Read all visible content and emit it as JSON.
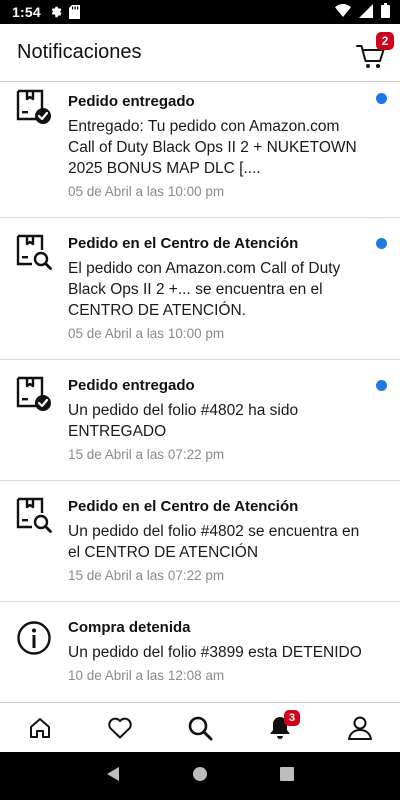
{
  "status_bar": {
    "time": "1:54"
  },
  "app_bar": {
    "title": "Notificaciones",
    "cart_count": "2"
  },
  "notifications": [
    {
      "icon": "box-check-icon",
      "title": "Pedido entregado",
      "body": "Entregado: Tu pedido con Amazon.com Call of Duty Black Ops II 2 + NUKETOWN 2025 BONUS MAP DLC [....",
      "date": "05 de Abril a las 10:00 pm",
      "unread": true
    },
    {
      "icon": "box-search-icon",
      "title": "Pedido en el Centro de Atención",
      "body": "El pedido con Amazon.com Call of Duty Black Ops II 2 +... se encuentra en el CENTRO DE ATENCIÓN.",
      "date": "05 de Abril a las 10:00 pm",
      "unread": true
    },
    {
      "icon": "box-check-icon",
      "title": "Pedido entregado",
      "body": "Un pedido del folio #4802 ha sido ENTREGADO",
      "date": "15 de Abril a las 07:22 pm",
      "unread": true
    },
    {
      "icon": "box-search-icon",
      "title": "Pedido en el Centro de Atención",
      "body": "Un pedido del folio #4802 se encuentra en el CENTRO DE ATENCIÓN",
      "date": "15 de Abril a las 07:22 pm",
      "unread": false
    },
    {
      "icon": "info-icon",
      "title": "Compra detenida",
      "body": "Un pedido del folio #3899 esta DETENIDO",
      "date": "10 de Abril a las 12:08 am",
      "unread": false
    }
  ],
  "bottom_nav": {
    "notifications_count": "3"
  },
  "colors": {
    "badge": "#d0021b",
    "unread_dot": "#1f7ae0"
  }
}
